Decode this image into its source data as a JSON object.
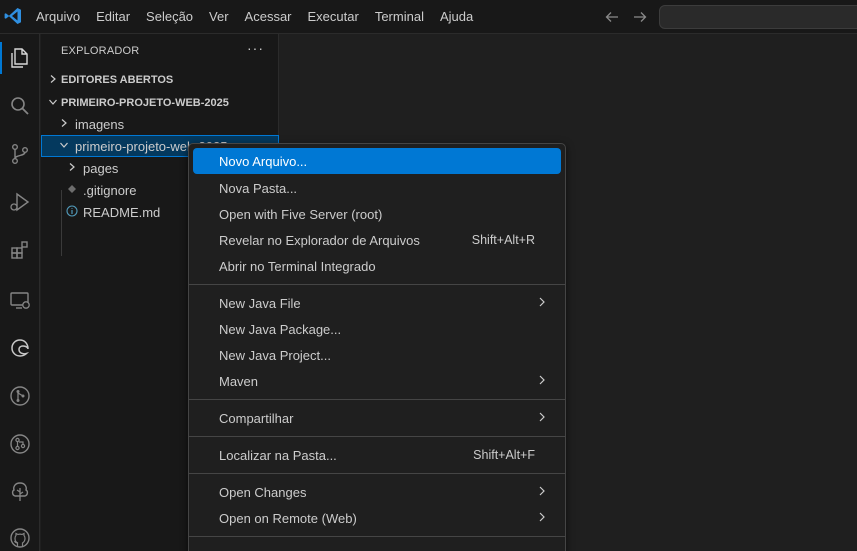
{
  "titlebar": {
    "menu": [
      "Arquivo",
      "Editar",
      "Seleção",
      "Ver",
      "Acessar",
      "Executar",
      "Terminal",
      "Ajuda"
    ]
  },
  "activitybar": {
    "icons": [
      "explorer-icon",
      "search-icon",
      "source-control-icon",
      "run-debug-icon",
      "extensions-icon",
      "remote-explorer-icon",
      "edge-devtools-icon",
      "git-graph-icon",
      "gitlens-icon",
      "tree-icon",
      "github-icon"
    ]
  },
  "sidebar": {
    "header": "EXPLORADOR",
    "more": "···",
    "sections": {
      "open_editors": "EDITORES ABERTOS",
      "project": "PRIMEIRO-PROJETO-WEB-2025"
    },
    "tree": {
      "imagens": "imagens",
      "folder": "primeiro-projeto-web-2025",
      "pages": "pages",
      "gitignore": ".gitignore",
      "readme": "README.md"
    }
  },
  "context_menu": {
    "items": [
      {
        "label": "Novo Arquivo...",
        "keys": ""
      },
      {
        "label": "Nova Pasta...",
        "keys": ""
      },
      {
        "label": "Open with Five Server (root)",
        "keys": ""
      },
      {
        "label": "Revelar no Explorador de Arquivos",
        "keys": "Shift+Alt+R"
      },
      {
        "label": "Abrir no Terminal Integrado",
        "keys": ""
      },
      {
        "label": "New Java File",
        "keys": ""
      },
      {
        "label": "New Java Package...",
        "keys": ""
      },
      {
        "label": "New Java Project...",
        "keys": ""
      },
      {
        "label": "Maven",
        "keys": ""
      },
      {
        "label": "Compartilhar",
        "keys": ""
      },
      {
        "label": "Localizar na Pasta...",
        "keys": "Shift+Alt+F"
      },
      {
        "label": "Open Changes",
        "keys": ""
      },
      {
        "label": "Open on Remote (Web)",
        "keys": ""
      }
    ]
  },
  "colors": {
    "accent": "#0078d4",
    "background": "#1f1f1f",
    "sidebar": "#181818"
  }
}
